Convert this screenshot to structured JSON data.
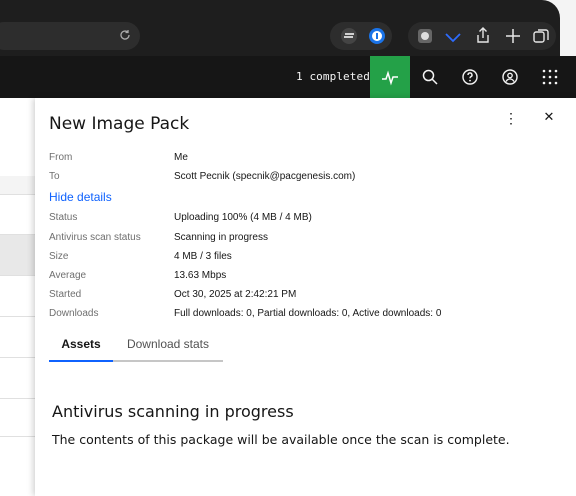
{
  "browser": {
    "icons": [
      "reload-icon",
      "sync-icon",
      "password-manager-icon",
      "extension-icon",
      "wifi-icon",
      "share-icon",
      "new-tab-icon",
      "tabs-icon"
    ]
  },
  "appbar": {
    "completed_text": "1 completed",
    "icons": [
      "activity-icon",
      "search-icon",
      "help-icon",
      "user-icon",
      "app-switcher-icon"
    ],
    "accent": "#24a148"
  },
  "panel": {
    "title": "New Image Pack",
    "hide_details": "Hide details",
    "details": [
      {
        "label": "From",
        "value": "Me"
      },
      {
        "label": "To",
        "value": "Scott Pecnik (specnik@pacgenesis.com)"
      },
      {
        "label": "Status",
        "value": "Uploading 100% (4 MB / 4 MB)"
      },
      {
        "label": "Antivirus scan status",
        "value": "Scanning in progress"
      },
      {
        "label": "Size",
        "value": "4 MB / 3 files"
      },
      {
        "label": "Average",
        "value": "13.63 Mbps"
      },
      {
        "label": "Started",
        "value": "Oct 30, 2025 at 2:42:21 PM"
      },
      {
        "label": "Downloads",
        "value": "Full downloads: 0, Partial downloads: 0, Active downloads: 0"
      }
    ],
    "tabs": [
      {
        "label": "Assets",
        "active": true
      },
      {
        "label": "Download stats",
        "active": false
      }
    ],
    "scan_title": "Antivirus scanning in progress",
    "scan_body": "The contents of this package will be available once the scan is complete.",
    "link_color": "#0f62fe"
  }
}
